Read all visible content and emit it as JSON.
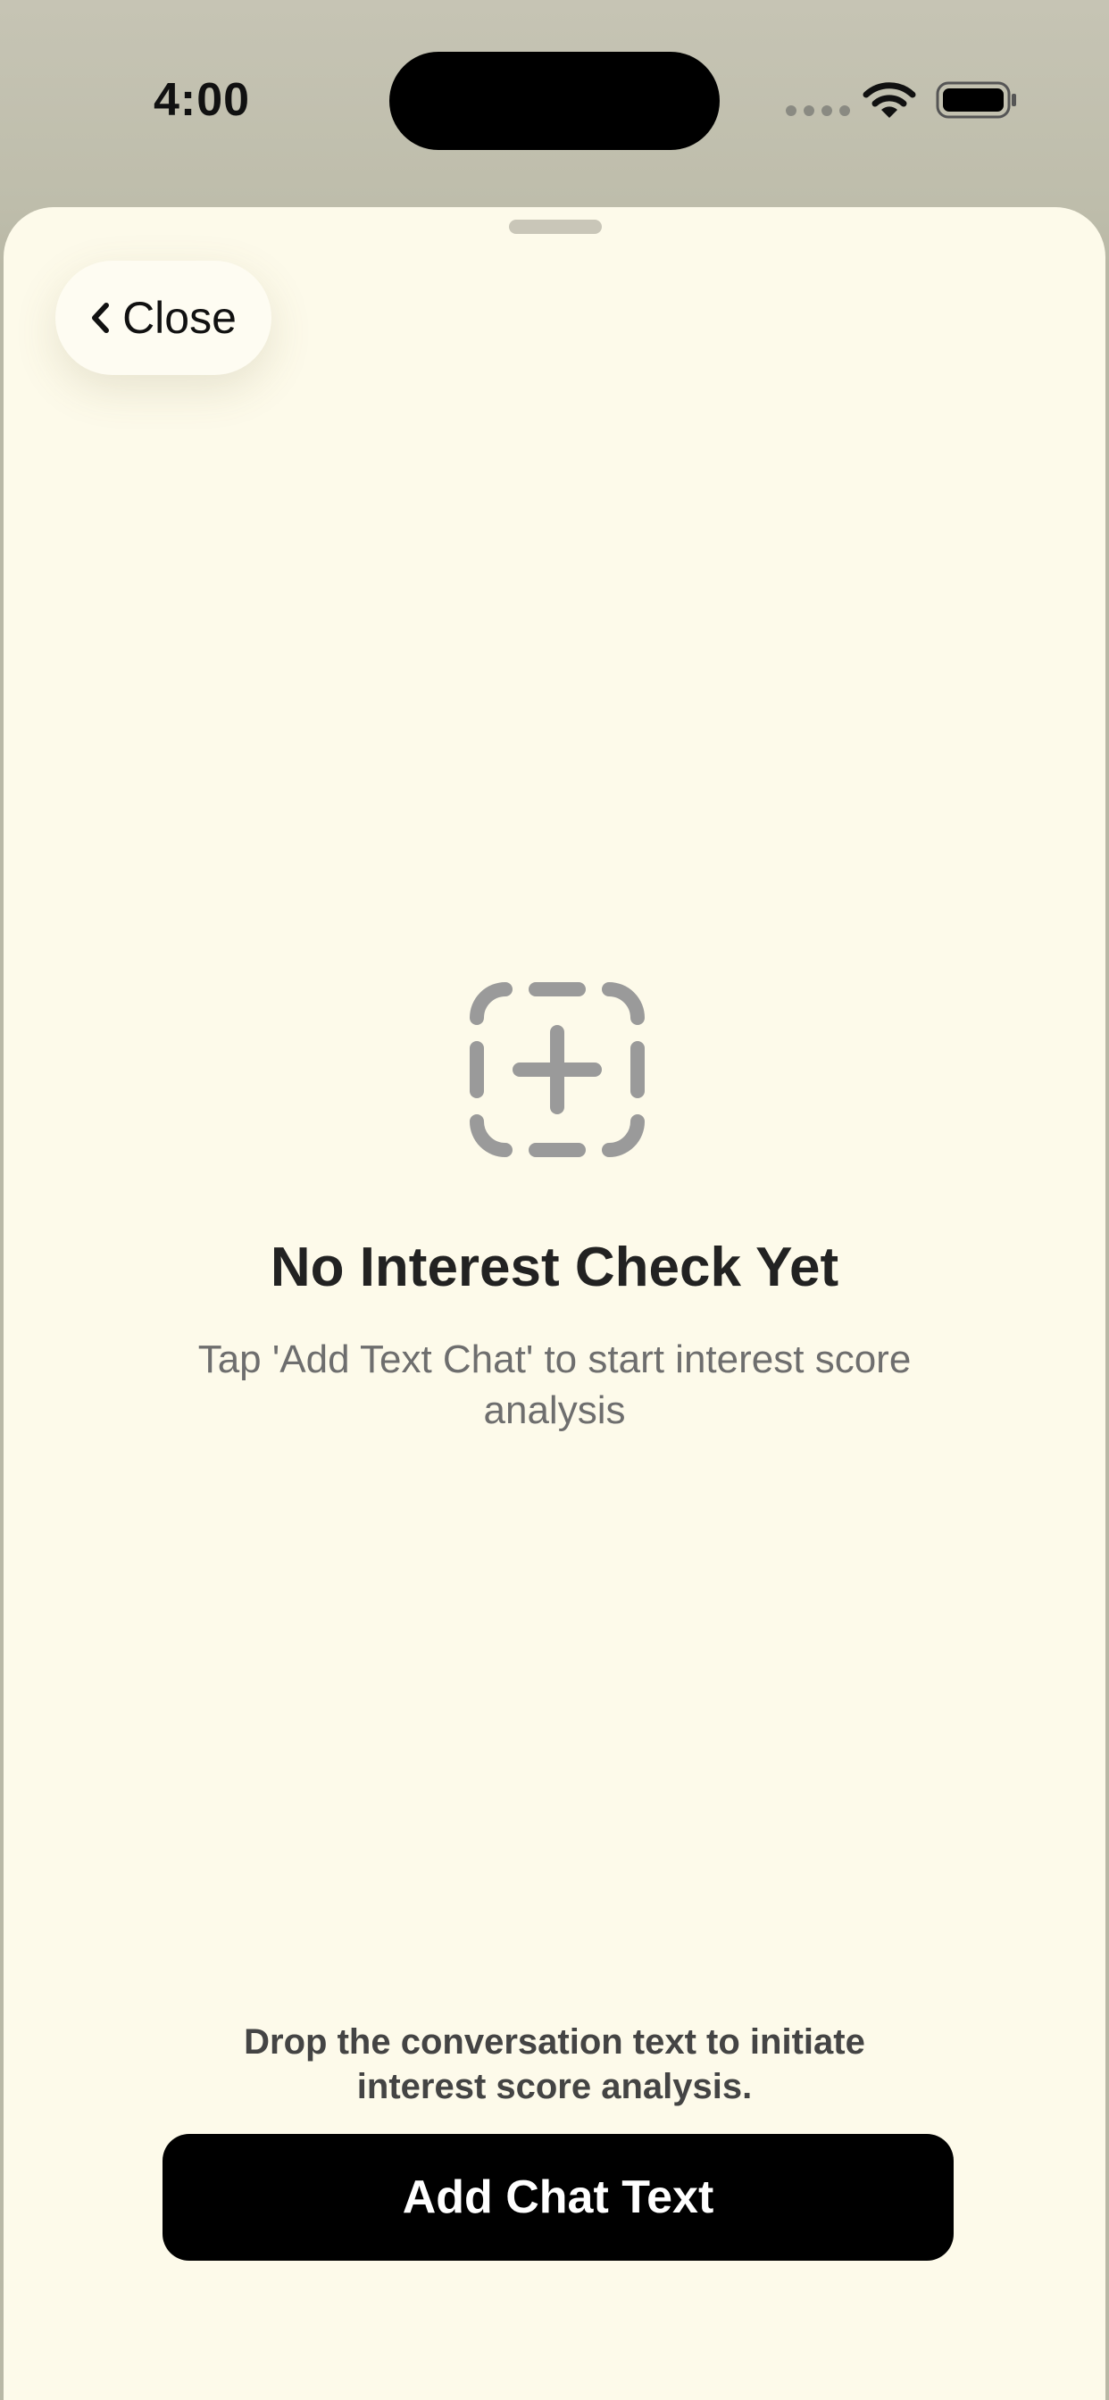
{
  "status_bar": {
    "time": "4:00"
  },
  "header": {
    "close_label": "Close"
  },
  "empty_state": {
    "icon": "dashed-square-plus-icon",
    "title": "No Interest Check Yet",
    "subtitle": "Tap 'Add Text Chat' to start interest score analysis"
  },
  "footer": {
    "hint": "Drop the conversation text to initiate interest score analysis.",
    "add_button_label": "Add Chat Text"
  },
  "colors": {
    "sheet_background": "#fdfaea",
    "button_background": "#000000",
    "icon_gray": "#9a9a9a"
  }
}
